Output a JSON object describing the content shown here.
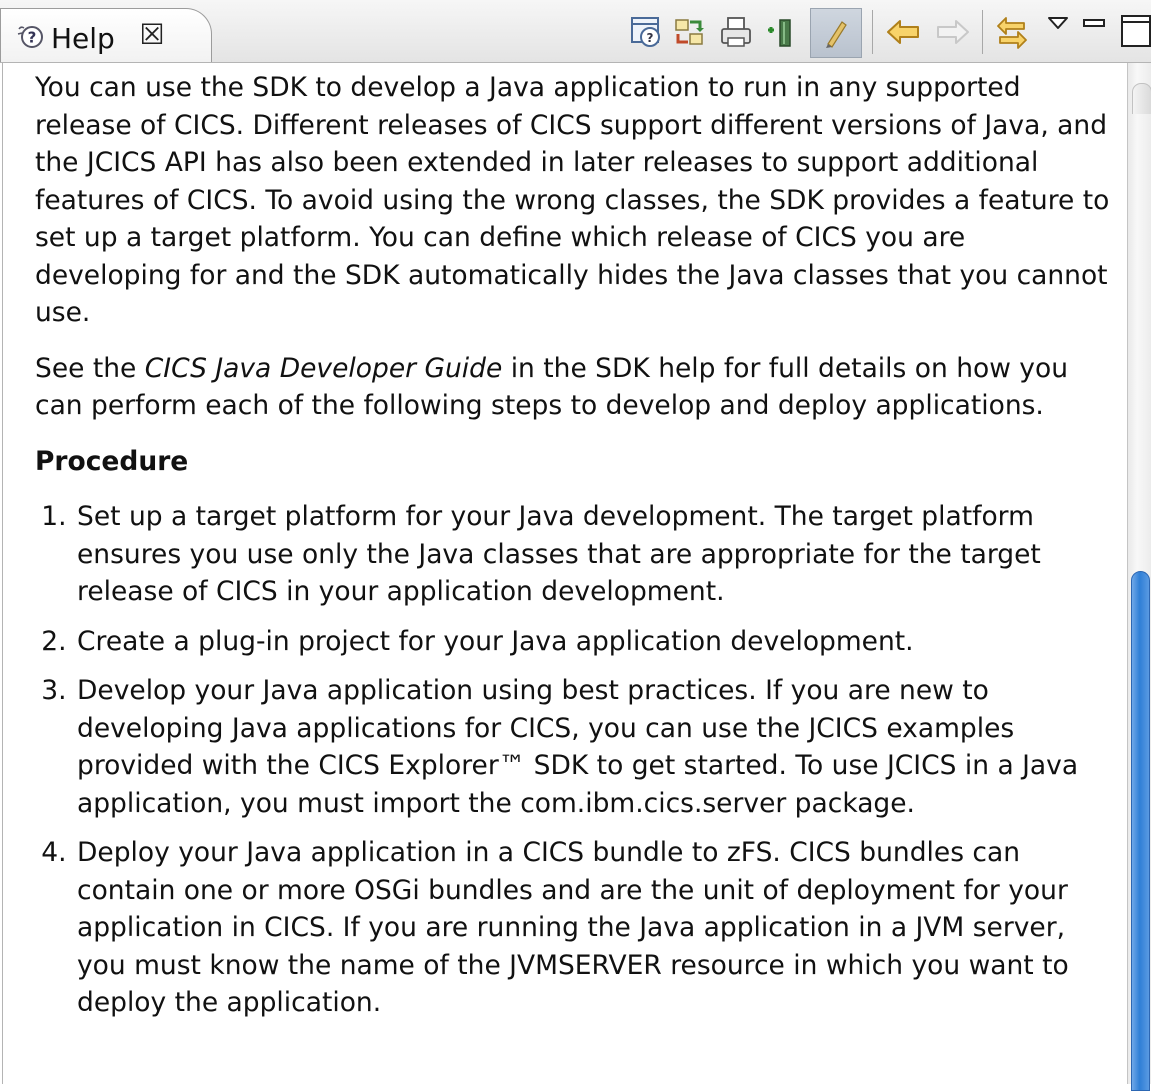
{
  "tab": {
    "label": "Help",
    "icon": "help-icon",
    "close_glyph": "☒"
  },
  "toolbar": {
    "buttons": [
      {
        "name": "show-in-contents-icon"
      },
      {
        "name": "sync-navigation-icon"
      },
      {
        "name": "print-icon"
      },
      {
        "name": "bookmark-add-icon"
      },
      {
        "name": "highlight-search-icon"
      },
      {
        "name": "back-arrow-icon"
      },
      {
        "name": "forward-arrow-icon"
      },
      {
        "name": "link-with-contents-icon"
      },
      {
        "name": "view-menu-icon"
      },
      {
        "name": "minimize-icon"
      },
      {
        "name": "maximize-icon"
      }
    ],
    "colors": {
      "arrow_enabled": "#f0b840",
      "arrow_disabled": "#d4d4d4"
    }
  },
  "document": {
    "intro": "You can use the SDK to develop a Java application to run in any supported release of CICS. Different releases of CICS support different versions of Java, and the JCICS API has also been extended in later releases to support additional features of CICS. To avoid using the wrong classes, the SDK provides a feature to set up a target platform. You can define which release of CICS you are developing for and the SDK automatically hides the Java classes that you cannot use.",
    "see_prefix": "See the ",
    "see_title": "CICS Java Developer Guide",
    "see_suffix": " in the SDK help for full details on how you can perform each of the following steps to develop and deploy applications.",
    "procedure_heading": "Procedure",
    "steps": [
      "Set up a target platform for your Java development. The target platform ensures you use only the Java classes that are appropriate for the target release of CICS in your application development.",
      "Create a plug-in project for your Java application development.",
      "Develop your Java application using best practices. If you are new to developing Java applications for CICS, you can use the JCICS examples provided with the CICS Explorer™ SDK to get started. To use JCICS in a Java application, you must import the com.ibm.cics.server package.",
      "Deploy your Java application in a CICS bundle to zFS. CICS bundles can contain one or more OSGi bundles and are the unit of deployment for your application in CICS. If you are running the Java application in a JVM server, you must know the name of the JVMSERVER resource in which you want to deploy the application."
    ]
  },
  "scrollbar": {
    "thumb_color": "#2f7fd6",
    "position_fraction": 0.5
  }
}
